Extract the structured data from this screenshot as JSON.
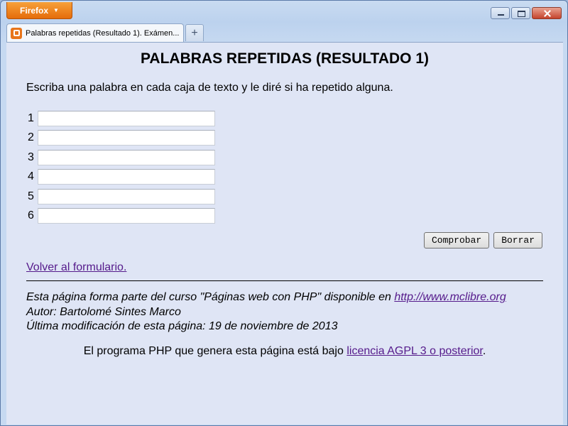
{
  "browser": {
    "app_button": "Firefox",
    "tab_title": "Palabras repetidas (Resultado 1). Exámen...",
    "new_tab": "+"
  },
  "page": {
    "title": "PALABRAS REPETIDAS (RESULTADO 1)",
    "intro": "Escriba una palabra en cada caja de texto y le diré si ha repetido alguna.",
    "rows": [
      {
        "number": "1",
        "value": ""
      },
      {
        "number": "2",
        "value": ""
      },
      {
        "number": "3",
        "value": ""
      },
      {
        "number": "4",
        "value": ""
      },
      {
        "number": "5",
        "value": ""
      },
      {
        "number": "6",
        "value": ""
      }
    ],
    "check_button": "Comprobar",
    "clear_button": "Borrar",
    "back_link": "Volver al formulario.",
    "footer": {
      "line1_text": "Esta página forma parte del curso \"Páginas web con PHP\" disponible en ",
      "line1_link": "http://www.mclibre.org",
      "line2": "Autor: Bartolomé Sintes Marco",
      "line3": "Última modificación de esta página: 19 de noviembre de 2013"
    },
    "license": {
      "text": "El programa PHP que genera esta página está bajo ",
      "link": "licencia AGPL 3 o posterior",
      "end": "."
    }
  },
  "colors": {
    "page_background": "#dfe5f5",
    "link_visited": "#551a8b",
    "firefox_button": "#e56c0a"
  }
}
